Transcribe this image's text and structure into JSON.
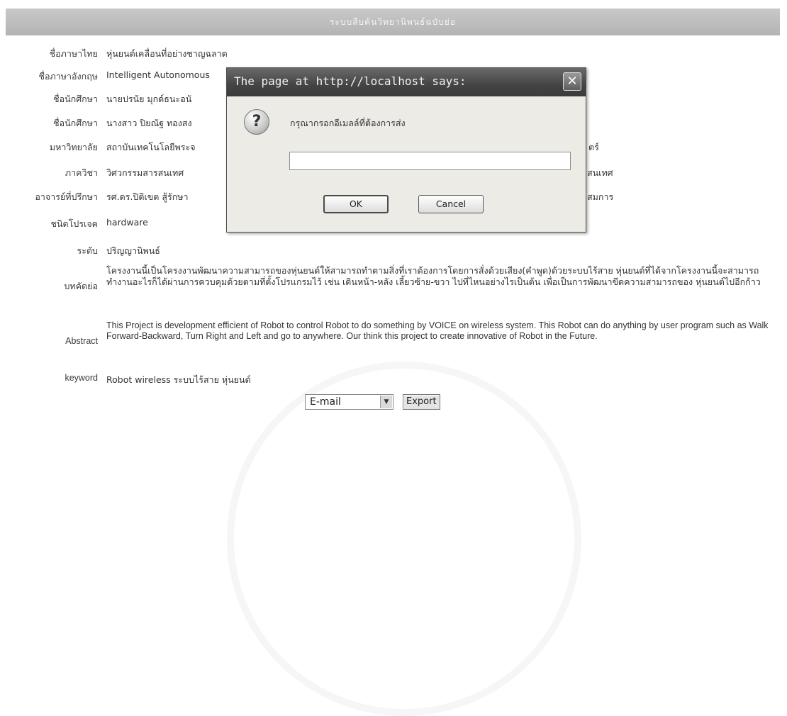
{
  "header": {
    "title": "ระบบสืบค้นวิทยานิพนธ์ฉบับย่อ"
  },
  "fields": [
    {
      "label": "ชื่อภาษาไทย",
      "value": "หุ่นยนต์เคลื่อนที่อย่างชาญฉลาด"
    },
    {
      "label": "ชื่อภาษาอังกฤษ",
      "value": "Intelligent Autonomous"
    },
    {
      "label": "ชื่อนักศึกษา",
      "value": "นายปรนัย มุกด์ธนะอนั"
    },
    {
      "label": "ชื่อนักศึกษา",
      "value": "นางสาว ปิยณัฐ ทองสง"
    },
    {
      "label": "มหาวิทยาลัย",
      "value": "สถาบันเทคโนโลยีพระจ"
    },
    {
      "label": "ภาควิชา",
      "value": "วิศวกรรมสารสนเทศ"
    },
    {
      "label": "อาจารย์ที่ปรึกษา",
      "value": "รศ.ดร.ปิติเขต สู้รักษา"
    },
    {
      "label": "ชนิดโปรเจค",
      "value": "hardware"
    },
    {
      "label": "ระดับ",
      "value": "ปริญญานิพนธ์"
    }
  ],
  "partial_right": {
    "row5": "ตร์",
    "row6": "สนเทศ",
    "row7": "สมการ"
  },
  "abstract_th": {
    "label": "บทคัดย่อ",
    "text": "โครงงานนี้เป็นโครงงานพัฒนาความสามารถของหุ่นยนต์ให้สามารถทำตามสิ่งที่เราต้องการโดยการสั่งด้วยเสียง(คำพูด)ด้วยระบบไร้สาย หุ่นยนต์ที่ได้จากโครงงานนี้จะสามารถทำงานอะไรก็ได้ผ่านการควบคุมด้วยตามที่ตั้งโปรแกรมไว้ เช่น เดินหน้า-หลัง เลี้ยวซ้าย-ขวา ไปที่ไหนอย่างไรเป็นต้น เพื่อเป็นการพัฒนาขีดความสามารถของ หุ่นยนต์ไปอีกก้าว"
  },
  "abstract_en": {
    "label": "Abstract",
    "text": "This Project is development efficient of Robot to control Robot to do something by VOICE on wireless system. This Robot can do anything by user program such as Walk Forward-Backward, Turn Right and Left and go to anywhere. Our think this project to create innovative of Robot in the Future."
  },
  "keyword": {
    "label": "keyword",
    "value": "Robot wireless ระบบไร้สาย หุ่นยนต์"
  },
  "export": {
    "select_value": "E-mail",
    "button_label": "Export"
  },
  "dialog": {
    "title": "The page at http://localhost says:",
    "close_glyph": "✕",
    "icon_glyph": "?",
    "prompt": "กรุณากรอกอีเมลล์ที่ต้องการส่ง",
    "input_value": "",
    "ok_label": "OK",
    "cancel_label": "Cancel"
  },
  "icons": {
    "dropdown": "chevron-down-icon",
    "question": "question-icon",
    "close": "close-icon"
  }
}
